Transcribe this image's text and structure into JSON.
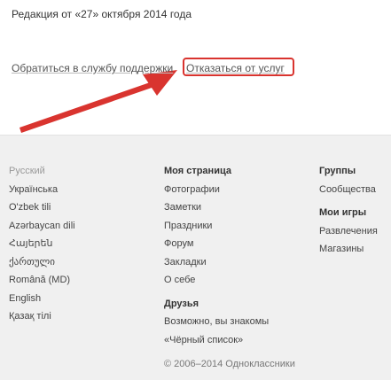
{
  "edition_text": "Редакция от «27» октября 2014 года",
  "support_link": "Обратиться в службу поддержки",
  "cancel_link": "Отказаться от услуг",
  "accent_color": "#d9342f",
  "languages": {
    "current": "Русский",
    "items": [
      "Українська",
      "O'zbek tili",
      "Azərbaycan dili",
      "Հայերեն",
      "ქართული",
      "Română (MD)",
      "English",
      "Қазақ тілі"
    ]
  },
  "my_page": {
    "heading": "Моя страница",
    "items": [
      "Фотографии",
      "Заметки",
      "Праздники",
      "Форум",
      "Закладки",
      "О себе"
    ]
  },
  "friends": {
    "heading": "Друзья",
    "items": [
      "Возможно, вы знакомы",
      "«Чёрный список»"
    ]
  },
  "groups": {
    "heading": "Группы",
    "items": [
      "Сообщества"
    ]
  },
  "my_games": {
    "heading": "Мои игры",
    "items": [
      "Развлечения",
      "Магазины"
    ]
  },
  "copyright": "© 2006–2014 Одноклассники"
}
